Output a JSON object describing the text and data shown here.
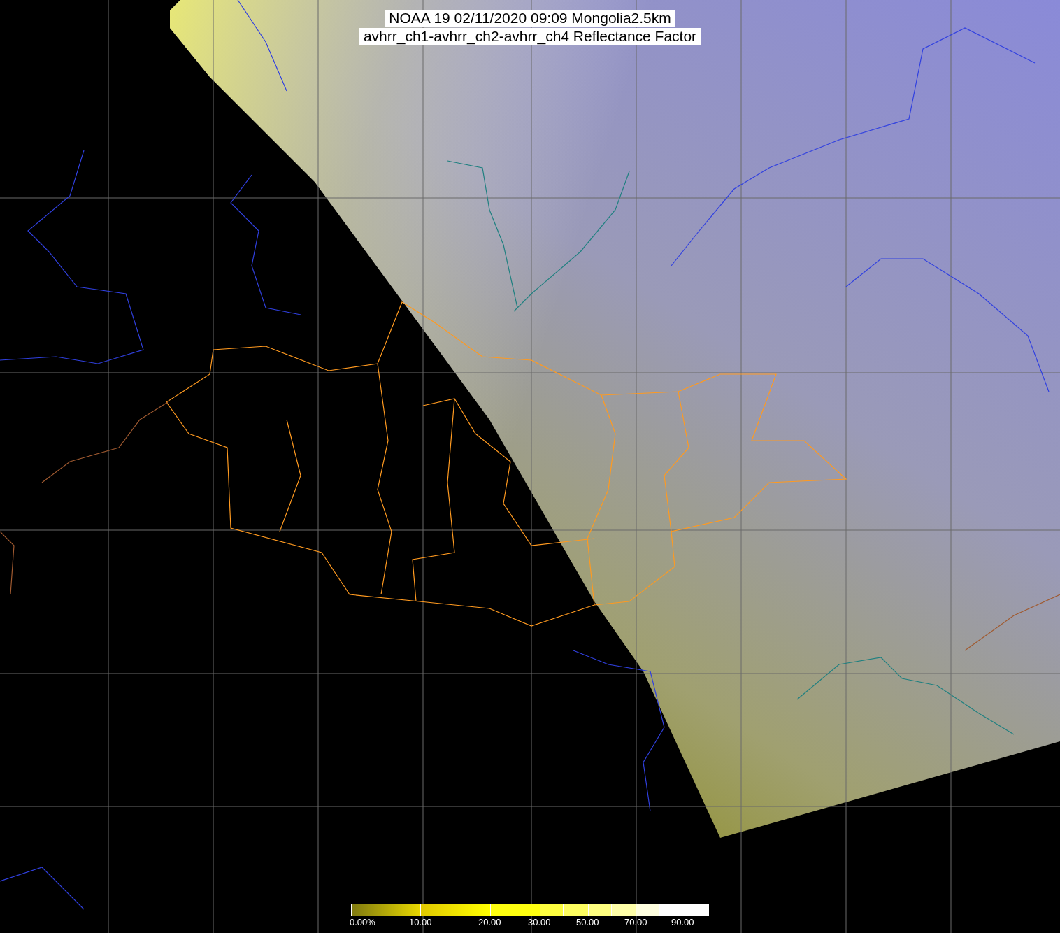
{
  "title": {
    "line_1": "NOAA 19 02/11/2020 09:09 Mongolia2.5km",
    "line_2": "avhrr_ch1-avhrr_ch2-avhrr_ch4 Reflectance Factor"
  },
  "colorbar": {
    "labels": [
      "0.00%",
      "10.00",
      "20.00",
      "30.00",
      "50.00",
      "70.00",
      "90.00"
    ]
  }
}
